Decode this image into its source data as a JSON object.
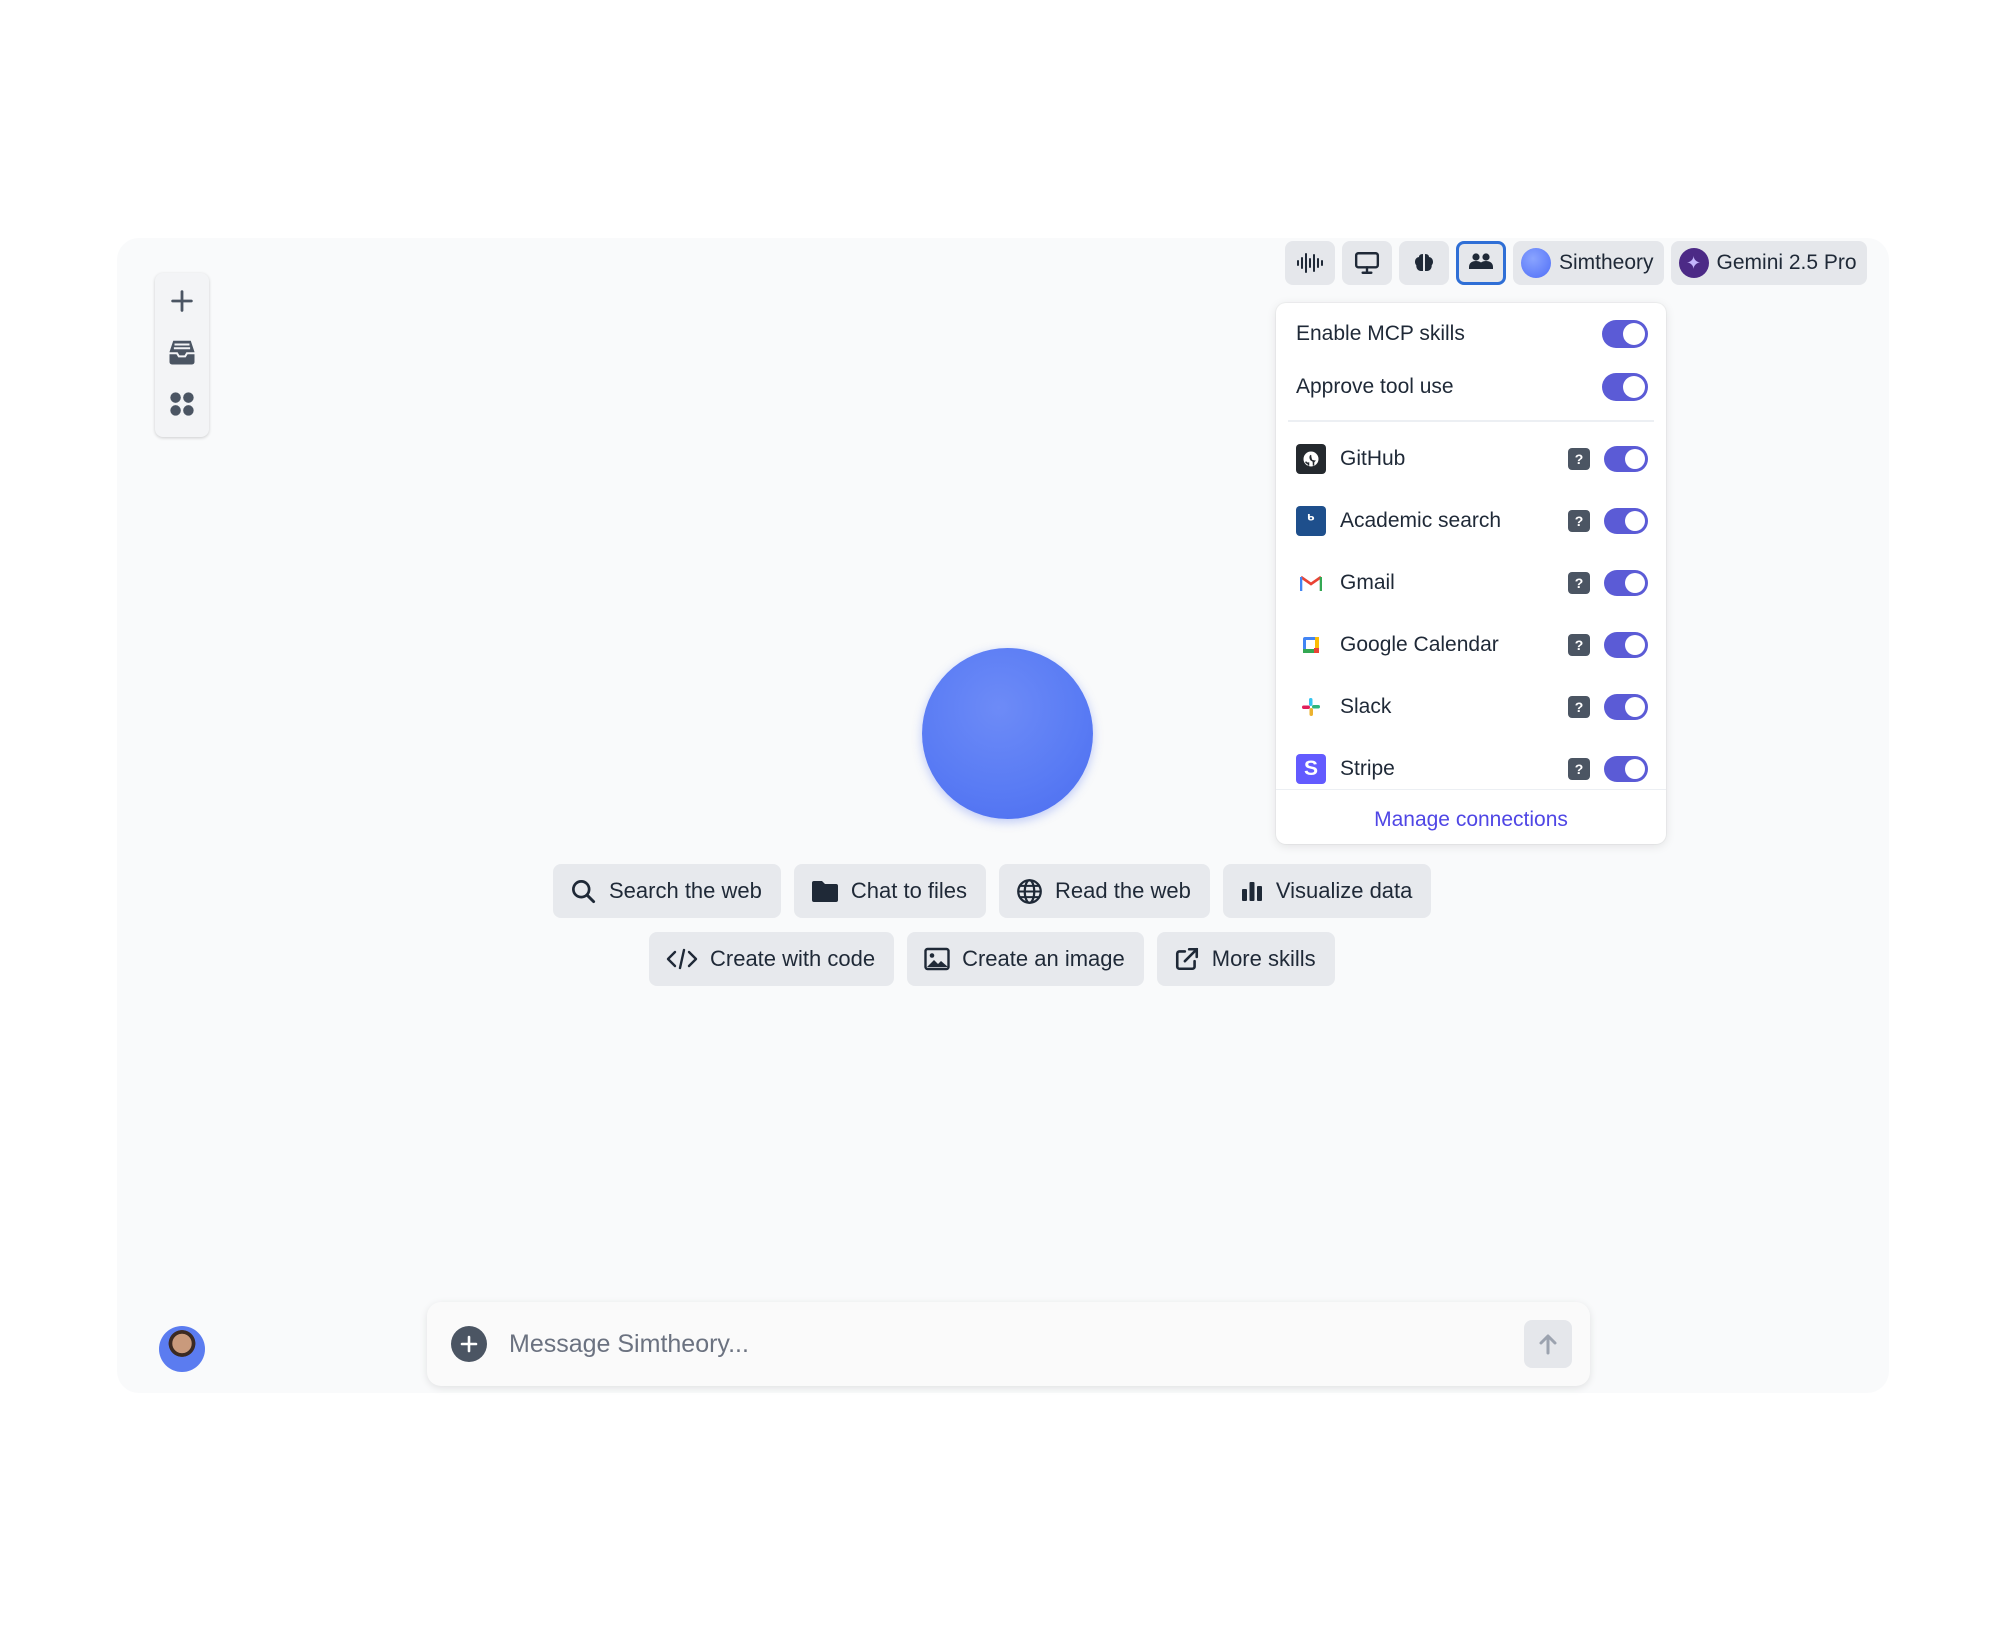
{
  "left_rail": {
    "items": [
      {
        "icon": "plus-icon"
      },
      {
        "icon": "inbox-icon"
      },
      {
        "icon": "apps-grid-icon"
      }
    ]
  },
  "toolbar": {
    "icons": [
      "voice-waveform-icon",
      "monitor-icon",
      "brain-icon",
      "mcp-skills-icon"
    ],
    "active_icon": "mcp-skills-icon",
    "assistant_label": "Simtheory",
    "model_label": "Gemini 2.5 Pro"
  },
  "mcp_panel": {
    "options": [
      {
        "label": "Enable MCP skills",
        "enabled": true
      },
      {
        "label": "Approve tool use",
        "enabled": true
      }
    ],
    "services": [
      {
        "name": "GitHub",
        "enabled": true
      },
      {
        "name": "Academic search",
        "enabled": true
      },
      {
        "name": "Gmail",
        "enabled": true
      },
      {
        "name": "Google Calendar",
        "enabled": true
      },
      {
        "name": "Slack",
        "enabled": true
      },
      {
        "name": "Stripe",
        "enabled": true
      }
    ],
    "manage_label": "Manage connections"
  },
  "skills": {
    "row1": [
      {
        "label": "Search the web",
        "icon": "search-icon"
      },
      {
        "label": "Chat to files",
        "icon": "folder-icon"
      },
      {
        "label": "Read the web",
        "icon": "globe-icon"
      },
      {
        "label": "Visualize data",
        "icon": "bar-chart-icon"
      }
    ],
    "row2": [
      {
        "label": "Create with code",
        "icon": "code-icon"
      },
      {
        "label": "Create an image",
        "icon": "image-icon"
      },
      {
        "label": "More skills",
        "icon": "external-link-icon"
      }
    ]
  },
  "composer": {
    "placeholder": "Message Simtheory..."
  },
  "colors": {
    "accent": "#5b5bd6",
    "link": "#4f46e5",
    "active_outline": "#2f6fd6",
    "orb": "#5a7cf4"
  }
}
